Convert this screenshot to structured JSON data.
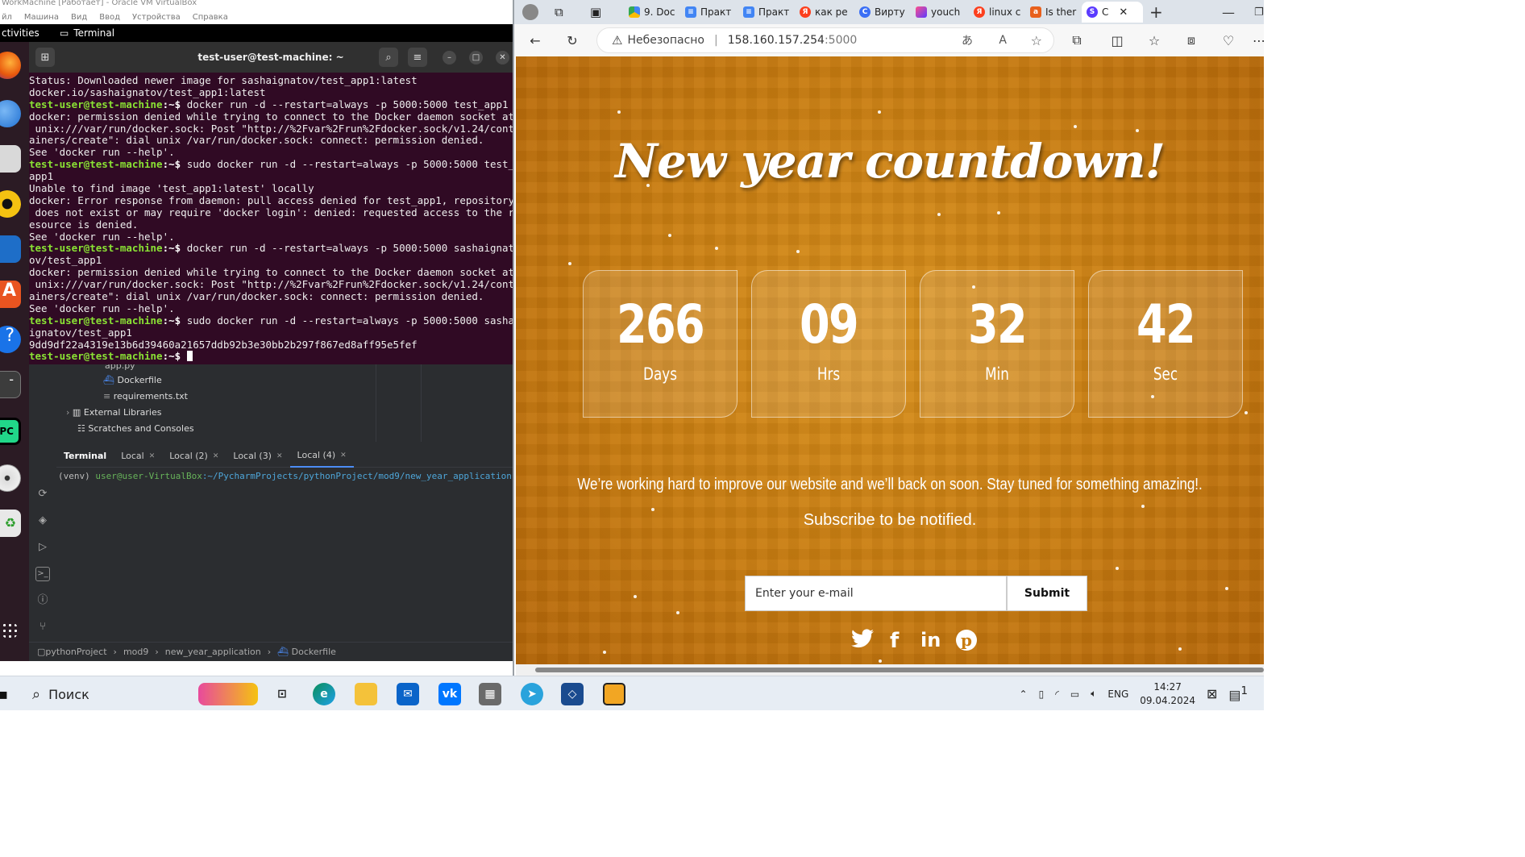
{
  "vbox": {
    "title": "WorkMachine [Работает] - Oracle VM VirtualBox",
    "menu": [
      "йл",
      "Машина",
      "Вид",
      "Ввод",
      "Устройства",
      "Справка"
    ]
  },
  "gnome": {
    "activities": "ctivities",
    "app": "Terminal"
  },
  "terminal": {
    "title": "test-user@test-machine: ~",
    "prompt": "test-user@test-machine",
    "lines": [
      {
        "t": "o",
        "text": "Status: Downloaded newer image for sashaignatov/test_app1:latest"
      },
      {
        "t": "o",
        "text": "docker.io/sashaignatov/test_app1:latest"
      },
      {
        "t": "c",
        "text": "docker run -d --restart=always -p 5000:5000 test_app1"
      },
      {
        "t": "o",
        "text": "docker: permission denied while trying to connect to the Docker daemon socket at"
      },
      {
        "t": "o",
        "text": " unix:///var/run/docker.sock: Post \"http://%2Fvar%2Frun%2Fdocker.sock/v1.24/cont"
      },
      {
        "t": "o",
        "text": "ainers/create\": dial unix /var/run/docker.sock: connect: permission denied."
      },
      {
        "t": "o",
        "text": "See 'docker run --help'."
      },
      {
        "t": "c",
        "text": "sudo docker run -d --restart=always -p 5000:5000 test_"
      },
      {
        "t": "o",
        "text": "app1"
      },
      {
        "t": "o",
        "text": "Unable to find image 'test_app1:latest' locally"
      },
      {
        "t": "o",
        "text": "docker: Error response from daemon: pull access denied for test_app1, repository"
      },
      {
        "t": "o",
        "text": " does not exist or may require 'docker login': denied: requested access to the r"
      },
      {
        "t": "o",
        "text": "esource is denied."
      },
      {
        "t": "o",
        "text": "See 'docker run --help'."
      },
      {
        "t": "c",
        "text": "docker run -d --restart=always -p 5000:5000 sashaignat"
      },
      {
        "t": "o",
        "text": "ov/test_app1"
      },
      {
        "t": "o",
        "text": "docker: permission denied while trying to connect to the Docker daemon socket at"
      },
      {
        "t": "o",
        "text": " unix:///var/run/docker.sock: Post \"http://%2Fvar%2Frun%2Fdocker.sock/v1.24/cont"
      },
      {
        "t": "o",
        "text": "ainers/create\": dial unix /var/run/docker.sock: connect: permission denied."
      },
      {
        "t": "o",
        "text": "See 'docker run --help'."
      },
      {
        "t": "c",
        "text": "sudo docker run -d --restart=always -p 5000:5000 sasha"
      },
      {
        "t": "o",
        "text": "ignatov/test_app1"
      },
      {
        "t": "o",
        "text": "9dd9df22a4319e13b6d39460a21657ddb92b3e30bb2b297f867ed8aff95e5fef"
      },
      {
        "t": "e",
        "text": ""
      }
    ]
  },
  "ide": {
    "tree": [
      "app.py",
      "Dockerfile",
      "requirements.txt",
      "External Libraries",
      "Scratches and Consoles"
    ],
    "tabs": [
      {
        "label": "Terminal",
        "closable": false
      },
      {
        "label": "Local",
        "closable": true
      },
      {
        "label": "Local (2)",
        "closable": true
      },
      {
        "label": "Local (3)",
        "closable": true
      },
      {
        "label": "Local (4)",
        "closable": true,
        "active": true
      }
    ],
    "term_venv": "(venv) ",
    "term_user": "user@user-VirtualBox",
    "term_path": ":~/PycharmProjects/pythonProject/mod9/new_year_application",
    "breadcrumb": [
      "pythonProject",
      "mod9",
      "new_year_application",
      "Dockerfile"
    ]
  },
  "browser": {
    "tabs": [
      "9. Doc",
      "Практ",
      "Практ",
      "как ре",
      "Вирту",
      "youch",
      "linux c",
      "Is ther",
      "С"
    ],
    "not_secure": "Небезопасно",
    "url": "158.160.157.254",
    "url_port": ":5000"
  },
  "site": {
    "headline": "New year countdown!",
    "countdown": [
      {
        "value": "266",
        "label": "Days"
      },
      {
        "value": "09",
        "label": "Hrs"
      },
      {
        "value": "32",
        "label": "Min"
      },
      {
        "value": "42",
        "label": "Sec"
      }
    ],
    "message": "We’re working hard to improve our website and we’ll back on soon. Stay tuned for something amazing!.",
    "subscribe": "Subscribe to be notified.",
    "email_placeholder": "Enter your e-mail",
    "submit": "Submit",
    "social": [
      "twitter-icon",
      "facebook-icon",
      "linkedin-icon",
      "pinterest-icon"
    ]
  },
  "taskbar": {
    "search": "Поиск",
    "lang": "ENG",
    "time": "14:27",
    "date": "09.04.2024",
    "badge": "1"
  }
}
